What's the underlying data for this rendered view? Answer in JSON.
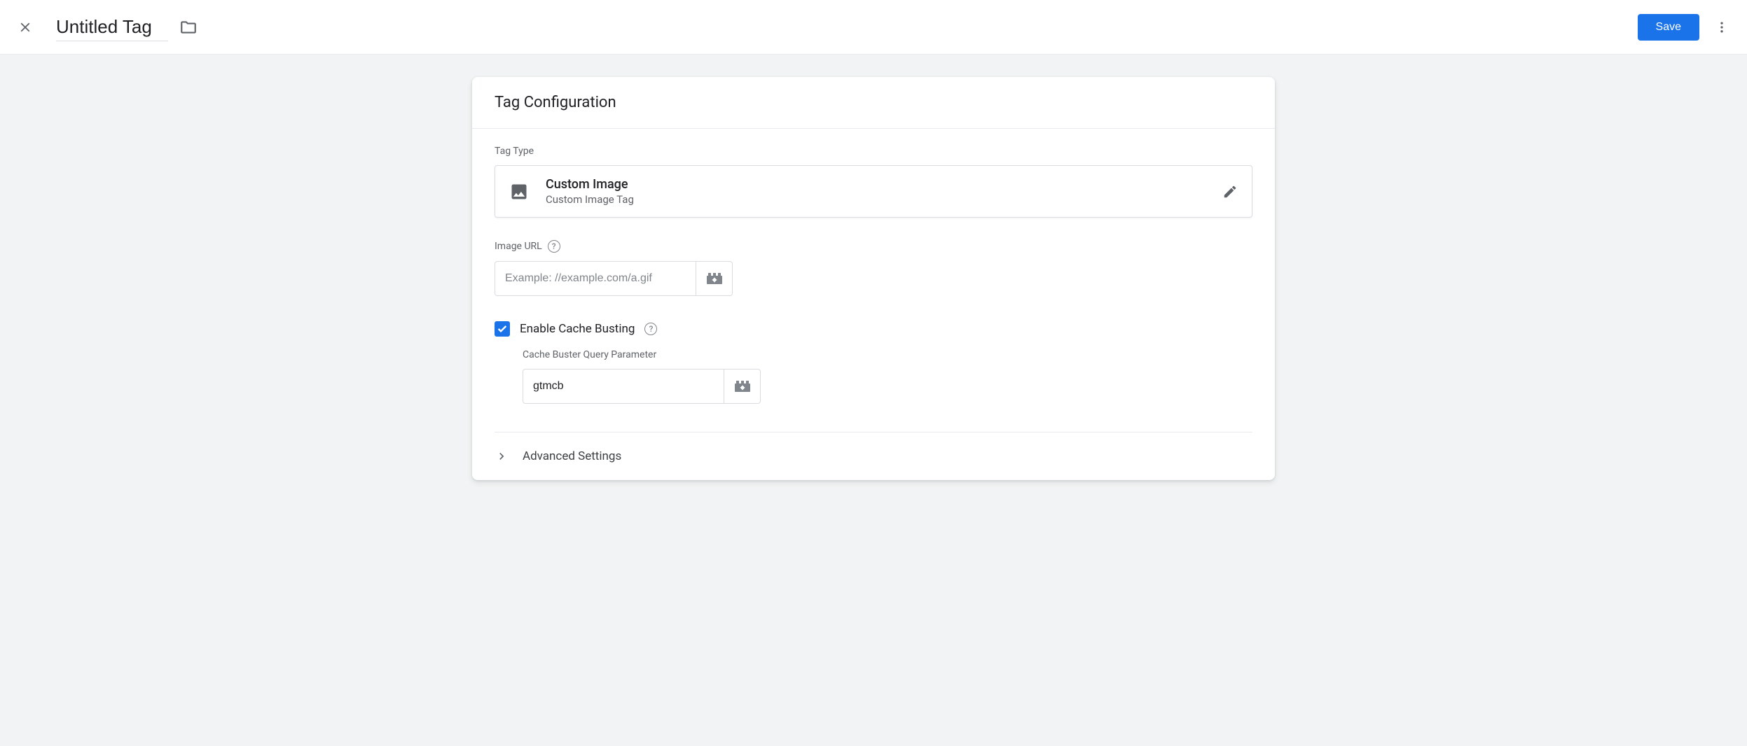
{
  "header": {
    "title": "Untitled Tag",
    "save_label": "Save"
  },
  "card": {
    "title": "Tag Configuration",
    "tag_type_label": "Tag Type",
    "tag_type": {
      "name": "Custom Image",
      "description": "Custom Image Tag"
    },
    "image_url": {
      "label": "Image URL",
      "placeholder": "Example: //example.com/a.gif",
      "value": ""
    },
    "cache_busting": {
      "checked": true,
      "label": "Enable Cache Busting",
      "param_label": "Cache Buster Query Parameter",
      "param_value": "gtmcb"
    },
    "advanced_label": "Advanced Settings"
  }
}
